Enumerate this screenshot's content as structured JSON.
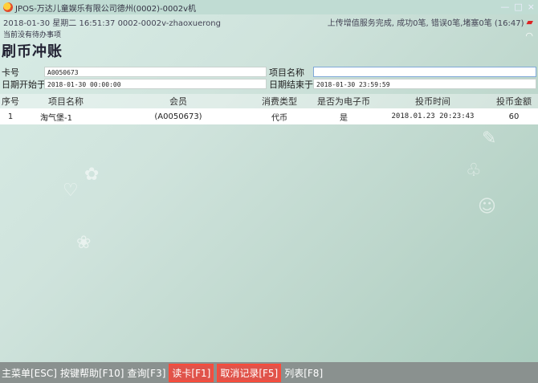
{
  "window": {
    "title": "JPOS-万达儿童娱乐有限公司德州(0002)-0002v机",
    "min": "—",
    "max": "□",
    "close": "×"
  },
  "status": {
    "left": "2018-01-30 星期二 16:51:37 0002-0002v-zhaoxuerong",
    "right": "上传增值服务完成, 成功0笔, 错误0笔,堵塞0笔 (16:47)",
    "notice": "当前没有待办事项"
  },
  "page": {
    "title": "刷币冲账"
  },
  "form": {
    "card_label": "卡号",
    "card_value": "A0050673",
    "item_label": "项目名称",
    "item_value": "",
    "start_label": "日期开始于",
    "start_value": "2018-01-30 00:00:00",
    "end_label": "日期结束于",
    "end_value": "2018-01-30 23:59:59"
  },
  "table": {
    "headers": [
      "序号",
      "项目名称",
      "会员",
      "消费类型",
      "是否为电子币",
      "投币时间",
      "投币金额"
    ],
    "rows": [
      [
        "1",
        "淘气堡-1",
        "(A0050673)",
        "代币",
        "是",
        "2018.01.23 20:23:43",
        "60"
      ]
    ]
  },
  "bottom": {
    "menu": "主菜单[ESC]",
    "help": "按键帮助[F10]",
    "query": "查询[F3]",
    "read_card": "读卡[F1]",
    "cancel": "取消记录[F5]",
    "list": "列表[F8]"
  },
  "colors": {
    "highlight": "#e0534a",
    "bar": "#8a918f"
  }
}
